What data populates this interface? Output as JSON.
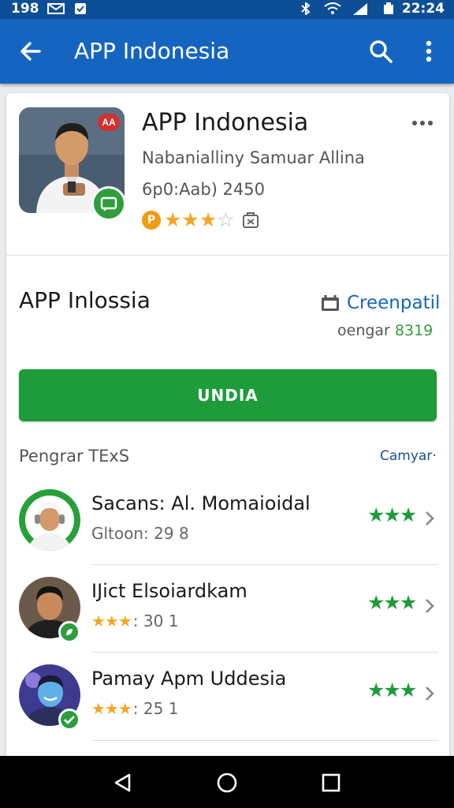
{
  "status_bar": {
    "time_left": "198",
    "time_right": "22:24"
  },
  "app_bar": {
    "title": "APP Indonesia"
  },
  "app": {
    "title": "APP Indonesia",
    "developer": "Nabanialliny Samuar Allina",
    "meta": "6p0:Aab) 2450",
    "rating_badge": "P",
    "stars_full": 3,
    "stars_total": 4,
    "icon_corner_badge": "AA"
  },
  "section": {
    "title": "APP Inlossia",
    "link": "Creenpatil",
    "sub_label": "oengar",
    "sub_value": "8319"
  },
  "install_button": "UNDIA",
  "list": {
    "header": "Pengrar TExS",
    "header_link": "Camyar·",
    "items": [
      {
        "title": "Sacans: Al. Momaioidal",
        "sub": "Gltoon: 29 8",
        "stars_text": "",
        "rating_stars": "★★★"
      },
      {
        "title": "IJict Elsoiardkam",
        "sub": ": 30 1",
        "stars_text": "★★★",
        "rating_stars": "★★★"
      },
      {
        "title": "Pamay Apm Uddesia",
        "sub": ": 25 1",
        "stars_text": "★★★",
        "rating_stars": "★★★"
      }
    ]
  },
  "colors": {
    "app_bar": "#1565c0",
    "status_bar": "#0d4f96",
    "install": "#1e9b3a",
    "star": "#f4a623",
    "link": "#1565c0"
  }
}
